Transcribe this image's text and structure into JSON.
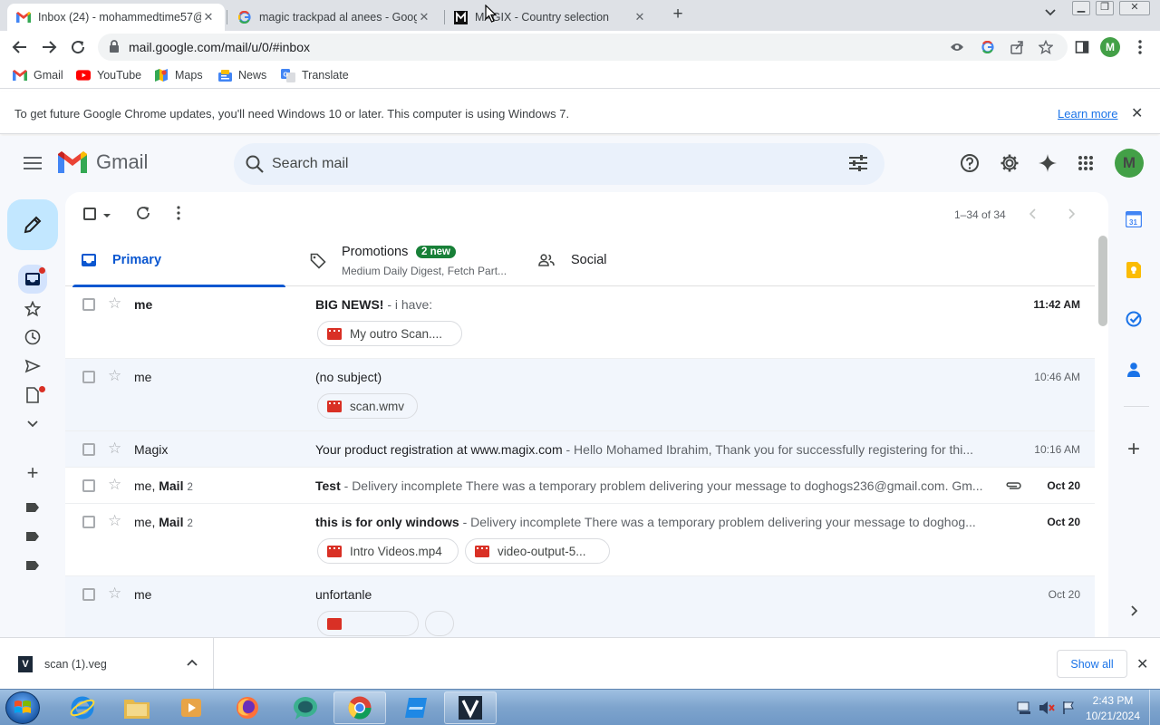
{
  "browser": {
    "tabs": [
      {
        "title": "Inbox (24) - mohammedtime57@",
        "favicon": "gmail-favicon",
        "active": true
      },
      {
        "title": "magic trackpad al anees - Google",
        "favicon": "google-favicon",
        "active": false
      },
      {
        "title": "MAGIX - Country selection",
        "favicon": "magix-favicon",
        "active": false
      }
    ],
    "url": "mail.google.com/mail/u/0/#inbox",
    "profile_initial": "M",
    "bookmarks": [
      {
        "label": "Gmail",
        "icon": "gmail-icon"
      },
      {
        "label": "YouTube",
        "icon": "youtube-icon"
      },
      {
        "label": "Maps",
        "icon": "maps-icon"
      },
      {
        "label": "News",
        "icon": "news-icon"
      },
      {
        "label": "Translate",
        "icon": "translate-icon"
      }
    ],
    "infobar": {
      "message": "To get future Google Chrome updates, you'll need Windows 10 or later. This computer is using Windows 7.",
      "link": "Learn more"
    }
  },
  "gmail": {
    "wordmark": "Gmail",
    "search_placeholder": "Search mail",
    "profile_initial": "M",
    "page_count": "1–34 of 34",
    "categories": {
      "primary": "Primary",
      "promotions": "Promotions",
      "promotions_badge": "2 new",
      "promotions_snippet": "Medium Daily Digest, Fetch Part...",
      "social": "Social"
    },
    "emails": [
      {
        "sender": "me",
        "count": "",
        "subject": "BIG NEWS!",
        "snippet": " - i have:",
        "time": "11:42 AM",
        "unread": true,
        "attachments": [
          "My outro Scan...."
        ]
      },
      {
        "sender": "me",
        "count": "",
        "subject": "(no subject)",
        "snippet": "",
        "time": "10:46 AM",
        "unread": false,
        "attachments": [
          "scan.wmv"
        ]
      },
      {
        "sender": "Magix",
        "count": "",
        "subject": "Your product registration at www.magix.com",
        "snippet": " - Hello Mohamed Ibrahim, Thank you for successfully registering for thi...",
        "time": "10:16 AM",
        "unread": false,
        "attachments": []
      },
      {
        "sender": "me, ",
        "sender_bold": "Mail",
        "count": "2",
        "subject": "Test",
        "snippet": " - Delivery incomplete There was a temporary problem delivering your message to doghogs236@gmail.com. Gm...",
        "time": "Oct 20",
        "unread": true,
        "attachments": []
      },
      {
        "sender": "me, ",
        "sender_bold": "Mail",
        "count": "2",
        "subject": "this is for only windows",
        "snippet": " - Delivery incomplete There was a temporary problem delivering your message to doghog...",
        "time": "Oct 20",
        "unread": true,
        "attachments": [
          "Intro Videos.mp4",
          "video-output-5..."
        ]
      },
      {
        "sender": "me",
        "count": "",
        "subject": "unfortanle",
        "snippet": "",
        "time": "Oct 20",
        "unread": false,
        "attachments": []
      }
    ]
  },
  "downloads": {
    "file": "scan (1).veg",
    "show_all": "Show all"
  },
  "taskbar": {
    "time": "2:43 PM",
    "date": "10/21/2024"
  },
  "colors": {
    "accent": "#0b57d0",
    "compose": "#c2e7ff",
    "badge_green": "#188038",
    "gmail_red": "#ea4335"
  }
}
